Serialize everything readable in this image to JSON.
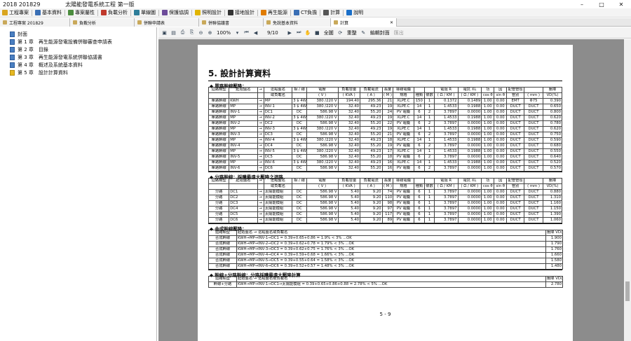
{
  "window": {
    "title": "2018 201829",
    "app_title": "太陽能發電系統工程 第一版",
    "minimize": "–",
    "maximize": "□",
    "close": "✕"
  },
  "menu": [
    {
      "label": "工程專案",
      "icon": "folder-icon",
      "color": "#d9a520"
    },
    {
      "label": "基本資料",
      "icon": "grid-icon",
      "color": "#3a6fb5"
    },
    {
      "label": "專案屬性",
      "icon": "list-icon",
      "color": "#4b8c3e"
    },
    {
      "label": "負載分析",
      "icon": "chart-icon",
      "color": "#c0392b"
    },
    {
      "label": "單線圖",
      "icon": "diagram-icon",
      "color": "#2d7d9a"
    },
    {
      "label": "保護協調",
      "icon": "shield-icon",
      "color": "#6d4c9a"
    },
    {
      "label": "照明設計",
      "icon": "bulb-icon",
      "color": "#e0b400"
    },
    {
      "label": "接地設計",
      "icon": "ground-icon",
      "color": "#333333"
    },
    {
      "label": "再生能源",
      "icon": "sun-icon",
      "color": "#e07b00"
    },
    {
      "label": "CT負擔",
      "icon": "ct-icon",
      "color": "#3a6fb5"
    },
    {
      "label": "計算",
      "icon": "calc-icon",
      "color": "#555555"
    },
    {
      "label": "說明",
      "icon": "help-icon",
      "color": "#1a6fc9"
    }
  ],
  "tabs": [
    {
      "label": "工程專案 201829"
    },
    {
      "label": "負載分析"
    },
    {
      "label": "併聯申請表"
    },
    {
      "label": "併聯協議書"
    },
    {
      "label": "免說基本資料"
    },
    {
      "label": "計算",
      "close": "✕"
    }
  ],
  "tree": [
    {
      "label": "封面"
    },
    {
      "label": "第 1 章　再生能源發電設備併聯審查申請表"
    },
    {
      "label": "第 2 章　目錄"
    },
    {
      "label": "第 3 章　再生能源發電系統併聯協議書"
    },
    {
      "label": "第 4 章　概述及系統基本資料"
    },
    {
      "label": "第 5 章　設計計算資料"
    }
  ],
  "toolbar": {
    "zoom": "100%",
    "page": "9/10",
    "fullscreen": "全圖",
    "refresh": "重整",
    "edit_cover": "編輯封面",
    "exit": "匯出"
  },
  "doc": {
    "chapter": "5. 設計計算資料",
    "page_no": "5 - 9",
    "sec1": "◆ 單路幹線壓降：",
    "sec2": "◆ 分路幹線：採購最遠大壓降之迴路",
    "sec3": "◆ 合成幹線壓降：",
    "sec4": "◆ 幹線+分路幹線：分路採購最遠大壓降計算",
    "h1": [
      "迴路類型",
      "起始盤名",
      "→",
      "迄點盤名\n或負載名",
      "相/線",
      "電壓\n( V )",
      "負載容量\n( KVA )",
      "負載電流\n( A )",
      "長度\n( M )",
      "導線電纜 規格",
      "導線電纜 種類",
      "導線電纜 條數",
      "電阻 R\n( Ω / KM )",
      "電抗 XL\n( Ω / KM )",
      "功因 cos θ",
      "功因 sin θ",
      "配管管徑 管別",
      "配管管徑 ( mm )",
      "壓降\nVD(%)"
    ],
    "h1a": [
      "迴路類型",
      "起始盤名",
      "→",
      "迄點盤名",
      "相 / 線",
      "電壓",
      "負載容量",
      "負載電流",
      "長度",
      "導線電纜",
      "",
      "",
      "電阻 R",
      "電抗 XL",
      "功",
      "因",
      "配管管徑",
      "",
      "壓降"
    ],
    "h1b": [
      "",
      "",
      "",
      "或負載名",
      "",
      "( V )",
      "( KVA )",
      "( A )",
      "( M )",
      "規格",
      "種類",
      "條數",
      "( Ω / KM )",
      "( Ω / KM )",
      "cos θ",
      "sin θ",
      "管別",
      "( mm )",
      "VD(%)"
    ],
    "rows1": [
      [
        "單路幹線",
        "KWH",
        "→",
        "MP",
        "3 $ 4W",
        "380 /220 V",
        "194.40",
        "295.36",
        "21",
        "XLPE.C",
        "150",
        "1",
        "0.1372",
        "0.1489",
        "1.00",
        "0.00",
        "EMT",
        "Φ75",
        "0.390"
      ],
      [
        "單路幹線",
        "MP",
        "→",
        "INV-1",
        "3 $ 4W",
        "380 /220 V",
        "32.40",
        "49.23",
        "19",
        "XLPE.C",
        "14",
        "1",
        "1.4533",
        "0.1988",
        "1.00",
        "0.00",
        "DUCT",
        "DUCT",
        "0.650"
      ],
      [
        "單路幹線",
        "INV-1",
        "→",
        "DC1",
        "DC",
        "586.98 V",
        "32.40",
        "55.20",
        "24",
        "PV 電纜",
        "6",
        "2",
        "3.7897",
        "0.0000",
        "1.00",
        "0.00",
        "DUCT",
        "DUCT",
        "0.800"
      ],
      [
        "單路幹線",
        "MP",
        "→",
        "INV-2",
        "3 $ 4W",
        "380 /220 V",
        "32.40",
        "49.23",
        "19",
        "XLPE.C",
        "14",
        "1",
        "1.4533",
        "0.1988",
        "1.00",
        "0.00",
        "DUCT",
        "DUCT",
        "0.620"
      ],
      [
        "單路幹線",
        "INV-2",
        "→",
        "DC2",
        "DC",
        "586.98 V",
        "32.40",
        "55.20",
        "22",
        "PV 電纜",
        "6",
        "2",
        "3.7897",
        "0.0000",
        "1.00",
        "0.00",
        "DUCT",
        "DUCT",
        "0.780"
      ],
      [
        "單路幹線",
        "MP",
        "→",
        "INV-3",
        "3 $ 4W",
        "380 /220 V",
        "32.40",
        "49.23",
        "19",
        "XLPE.C",
        "14",
        "1",
        "1.4533",
        "0.1988",
        "1.00",
        "0.00",
        "DUCT",
        "DUCT",
        "0.620"
      ],
      [
        "單路幹線",
        "INV-3",
        "→",
        "DC3",
        "DC",
        "586.98 V",
        "32.40",
        "55.20",
        "21",
        "PV 電纜",
        "6",
        "2",
        "3.7897",
        "0.0000",
        "1.00",
        "0.00",
        "DUCT",
        "DUCT",
        "0.750"
      ],
      [
        "單路幹線",
        "MP",
        "→",
        "INV-4",
        "3 $ 4W",
        "380 /220 V",
        "32.40",
        "49.23",
        "18",
        "XLPE.C",
        "14",
        "1",
        "1.4533",
        "0.1988",
        "1.00",
        "0.00",
        "DUCT",
        "DUCT",
        "0.590"
      ],
      [
        "單路幹線",
        "INV-4",
        "→",
        "DC4",
        "DC",
        "586.98 V",
        "32.40",
        "55.20",
        "19",
        "PV 電纜",
        "6",
        "2",
        "3.7897",
        "0.0000",
        "1.00",
        "0.00",
        "DUCT",
        "DUCT",
        "0.680"
      ],
      [
        "單路幹線",
        "MP",
        "→",
        "INV-5",
        "3 $ 4W",
        "380 /220 V",
        "32.40",
        "49.23",
        "17",
        "XLPE.C",
        "14",
        "1",
        "1.4533",
        "0.1988",
        "1.00",
        "0.00",
        "DUCT",
        "DUCT",
        "0.550"
      ],
      [
        "單路幹線",
        "INV-5",
        "→",
        "DC5",
        "DC",
        "586.98 V",
        "32.40",
        "55.20",
        "18",
        "PV 電纜",
        "6",
        "2",
        "3.7897",
        "0.0000",
        "1.00",
        "0.00",
        "DUCT",
        "DUCT",
        "0.640"
      ],
      [
        "單路幹線",
        "MP",
        "→",
        "INV-6",
        "3 $ 4W",
        "380 /220 V",
        "32.40",
        "49.23",
        "16",
        "XLPE.C",
        "14",
        "1",
        "1.4533",
        "0.1988",
        "1.00",
        "0.00",
        "DUCT",
        "DUCT",
        "0.520"
      ],
      [
        "單路幹線",
        "INV-6",
        "→",
        "DC6",
        "DC",
        "586.98 V",
        "32.40",
        "55.20",
        "16",
        "PV 電纜",
        "6",
        "2",
        "3.7897",
        "0.0000",
        "1.00",
        "0.00",
        "DUCT",
        "DUCT",
        "0.570"
      ]
    ],
    "rows2": [
      [
        "分路",
        "DC1",
        "→",
        "太陽能模組",
        "DC",
        "586.98 V",
        "5.40",
        "9.20",
        "74",
        "PV 電纜",
        "6",
        "1",
        "3.7897",
        "0.0000",
        "1.00",
        "0.00",
        "DUCT",
        "DUCT",
        "0.880"
      ],
      [
        "分路",
        "DC2",
        "→",
        "太陽能模組",
        "DC",
        "586.98 V",
        "5.40",
        "9.20",
        "110",
        "PV 電纜",
        "6",
        "1",
        "3.7897",
        "0.0000",
        "1.00",
        "0.00",
        "DUCT",
        "DUCT",
        "1.310"
      ],
      [
        "分路",
        "DC3",
        "→",
        "太陽能模組",
        "DC",
        "586.98 V",
        "5.40",
        "9.20",
        "98",
        "PV 電纜",
        "6",
        "1",
        "3.7897",
        "0.0000",
        "1.00",
        "0.00",
        "DUCT",
        "DUCT",
        "1.160"
      ],
      [
        "分路",
        "DC4",
        "→",
        "太陽能模組",
        "DC",
        "586.98 V",
        "5.40",
        "9.20",
        "97",
        "PV 電纜",
        "6",
        "1",
        "3.7897",
        "0.0000",
        "1.00",
        "0.00",
        "DUCT",
        "DUCT",
        "1.150"
      ],
      [
        "分路",
        "DC5",
        "→",
        "太陽能模組",
        "DC",
        "586.98 V",
        "5.40",
        "9.20",
        "117",
        "PV 電纜",
        "6",
        "1",
        "3.7897",
        "0.0000",
        "1.00",
        "0.00",
        "DUCT",
        "DUCT",
        "1.390"
      ],
      [
        "分路",
        "DC6",
        "→",
        "太陽能模組",
        "DC",
        "586.98 V",
        "5.40",
        "9.20",
        "89",
        "PV 電纜",
        "6",
        "1",
        "3.7897",
        "0.0000",
        "1.00",
        "0.00",
        "DUCT",
        "DUCT",
        "1.060"
      ]
    ],
    "h3": [
      "迴路類型",
      "起始盤名 → 迄點盤名或負載名",
      "壓降\nVD(%)"
    ],
    "rows3": [
      [
        "合成幹線",
        "KWH→MP→INV-1→DC1 = 0.39+0.65+0.86 = 1.9% < 3% ...OK",
        "1.900"
      ],
      [
        "合成幹線",
        "KWH→MP→INV-2→DC2 = 0.39+0.62+0.78 = 1.79% < 3% ...OK",
        "1.790"
      ],
      [
        "合成幹線",
        "KWH→MP→INV-3→DC3 = 0.39+0.62+0.75 = 1.76% < 3% ...OK",
        "1.760"
      ],
      [
        "合成幹線",
        "KWH→MP→INV-4→DC4 = 0.39+0.59+0.68 = 1.66% < 3% ...OK",
        "1.660"
      ],
      [
        "合成幹線",
        "KWH→MP→INV-5→DC5 = 0.39+0.55+0.64 = 1.58% < 3% ...OK",
        "1.580"
      ],
      [
        "合成幹線",
        "KWH→MP→INV-6→DC6 = 0.39+0.52+0.57 = 1.48% < 3% ...OK",
        "1.480"
      ]
    ],
    "rows4": [
      [
        "幹線+分路",
        "KWH→MP→INV-1→DC1→太陽能模組 = 0.39+0.65+0.86+0.88 = 2.78% < 5% ...OK",
        "2.780"
      ]
    ]
  }
}
